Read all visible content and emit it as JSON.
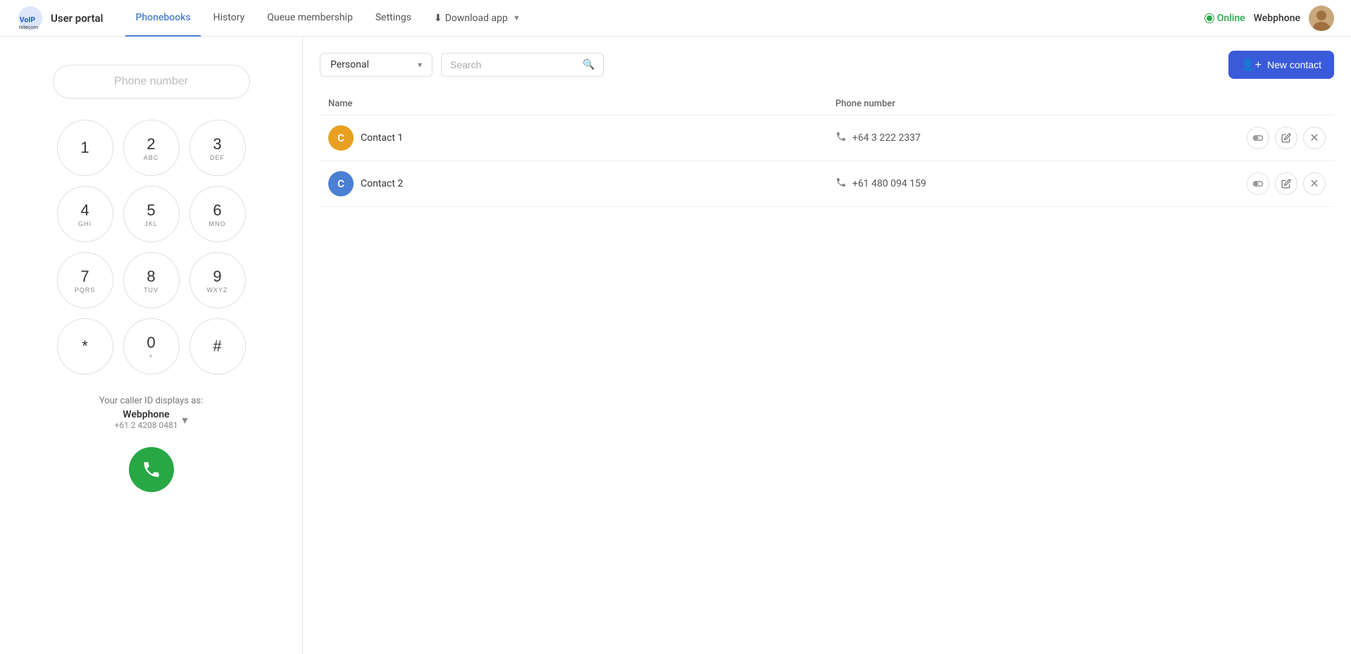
{
  "app": {
    "title": "User portal"
  },
  "header": {
    "status": "Online",
    "username": "Webphone"
  },
  "nav": {
    "items": [
      {
        "id": "phonebooks",
        "label": "Phonebooks",
        "active": true
      },
      {
        "id": "history",
        "label": "History",
        "active": false
      },
      {
        "id": "queue-membership",
        "label": "Queue membership",
        "active": false
      },
      {
        "id": "settings",
        "label": "Settings",
        "active": false
      }
    ],
    "download_app": "Download app"
  },
  "dialpad": {
    "phone_number_placeholder": "Phone number",
    "keys": [
      {
        "digit": "1",
        "sub": ""
      },
      {
        "digit": "2",
        "sub": "ABC"
      },
      {
        "digit": "3",
        "sub": "DEF"
      },
      {
        "digit": "4",
        "sub": "GHI"
      },
      {
        "digit": "5",
        "sub": "JKL"
      },
      {
        "digit": "6",
        "sub": "MNO"
      },
      {
        "digit": "7",
        "sub": "PQRS"
      },
      {
        "digit": "8",
        "sub": "TUV"
      },
      {
        "digit": "9",
        "sub": "WXYZ"
      },
      {
        "digit": "*",
        "sub": ""
      },
      {
        "digit": "0",
        "sub": "+"
      },
      {
        "digit": "#",
        "sub": ""
      }
    ],
    "caller_id_label": "Your caller ID displays as:",
    "caller_id_name": "Webphone",
    "caller_id_number": "+61 2 4208 0481"
  },
  "phonebook": {
    "selected_book": "Personal",
    "search_placeholder": "Search",
    "new_contact_label": "New contact",
    "table_headers": {
      "name": "Name",
      "phone": "Phone number"
    },
    "contacts": [
      {
        "id": "contact-1",
        "name": "Contact 1",
        "avatar_color": "#e8a020",
        "avatar_letter": "C",
        "phone": "+64 3 222 2337"
      },
      {
        "id": "contact-2",
        "name": "Contact 2",
        "avatar_color": "#4a7fd4",
        "avatar_letter": "C",
        "phone": "+61 480 094 159"
      }
    ]
  }
}
